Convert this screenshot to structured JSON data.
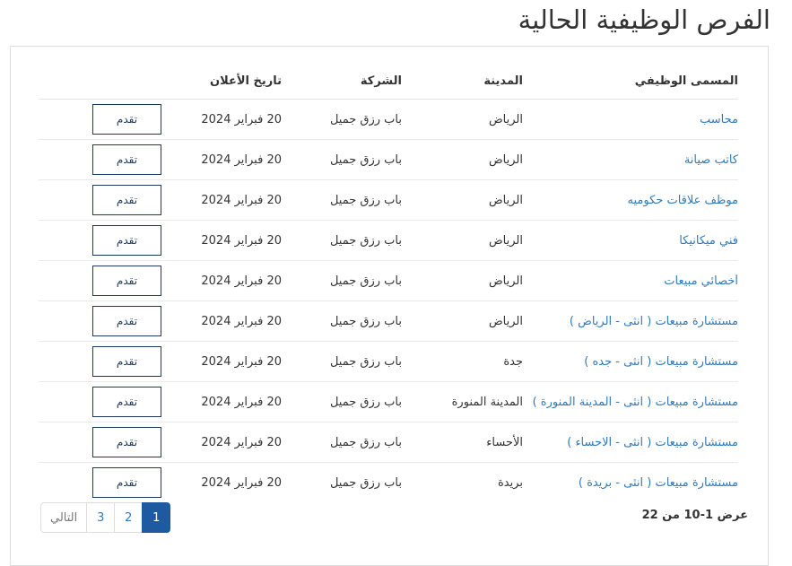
{
  "page": {
    "title": "الفرص الوظيفية الحالية"
  },
  "table": {
    "headers": {
      "title": "المسمى الوظيفي",
      "city": "المدينة",
      "company": "الشركة",
      "date": "تاريخ الأعلان"
    },
    "apply_label": "تقدم",
    "rows": [
      {
        "title": "محاسب",
        "city": "الرياض",
        "company": "باب رزق جميل",
        "date": "20 فبراير 2024"
      },
      {
        "title": "كاتب صيانة",
        "city": "الرياض",
        "company": "باب رزق جميل",
        "date": "20 فبراير 2024"
      },
      {
        "title": "موظف علاقات حكوميه",
        "city": "الرياض",
        "company": "باب رزق جميل",
        "date": "20 فبراير 2024"
      },
      {
        "title": "فني ميكانيكا",
        "city": "الرياض",
        "company": "باب رزق جميل",
        "date": "20 فبراير 2024"
      },
      {
        "title": "أخصائي مبيعات",
        "city": "الرياض",
        "company": "باب رزق جميل",
        "date": "20 فبراير 2024"
      },
      {
        "title": "مستشارة مبيعات ( انثى - الرياض )",
        "city": "الرياض",
        "company": "باب رزق جميل",
        "date": "20 فبراير 2024"
      },
      {
        "title": "مستشارة مبيعات ( انثى - جده )",
        "city": "جدة",
        "company": "باب رزق جميل",
        "date": "20 فبراير 2024"
      },
      {
        "title": "مستشارة مبيعات ( انثى - المدينة المنورة )",
        "city": "المدينة المنورة",
        "company": "باب رزق جميل",
        "date": "20 فبراير 2024"
      },
      {
        "title": "مستشارة مبيعات ( انثى - الاحساء )",
        "city": "الأحساء",
        "company": "باب رزق جميل",
        "date": "20 فبراير 2024"
      },
      {
        "title": "مستشارة مبيعات ( انثى - بريدة )",
        "city": "بريدة",
        "company": "باب رزق جميل",
        "date": "20 فبراير 2024"
      }
    ]
  },
  "summary": "عرض 1-10 من 22",
  "pagination": {
    "pages": [
      "1",
      "2",
      "3"
    ],
    "active": "1",
    "next_label": "التالي"
  },
  "colors": {
    "link": "#337ab7",
    "active_page": "#1e5aa0",
    "button_border": "#1f3a5f"
  }
}
